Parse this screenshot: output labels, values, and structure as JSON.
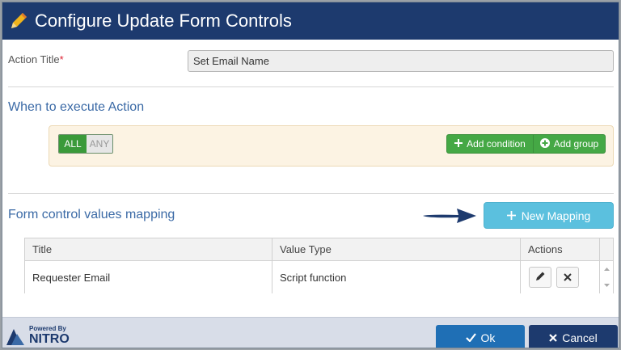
{
  "dialog": {
    "title": "Configure Update Form Controls",
    "icons": {
      "title": "pencil-icon"
    }
  },
  "action_title": {
    "label": "Action Title",
    "required_mark": "*",
    "value": "Set Email Name"
  },
  "execute": {
    "heading": "When to execute Action",
    "toggle_all": "ALL",
    "toggle_any": "ANY",
    "add_condition": "Add condition",
    "add_group": "Add group",
    "icons": {
      "add_condition": "plus-icon",
      "add_group": "plus-circle-icon"
    }
  },
  "mapping": {
    "heading": "Form control values mapping",
    "new_mapping": "New Mapping",
    "icons": {
      "new_mapping": "plus-icon",
      "pointer": "arrow-right-icon"
    },
    "columns": [
      "Title",
      "Value Type",
      "Actions"
    ],
    "rows": [
      {
        "title": "Requester Email",
        "value_type": "Script function"
      }
    ]
  },
  "footer": {
    "powered_by": "Powered By",
    "brand": "NITRO STUDIO™",
    "ok": "Ok",
    "cancel": "Cancel",
    "icons": {
      "ok": "check-icon",
      "cancel": "close-icon"
    }
  },
  "colors": {
    "header": "#1d3a6e",
    "accent_text": "#3b6aa6",
    "green": "#45a845",
    "info": "#5bc0de",
    "ok": "#1f6fb5"
  }
}
